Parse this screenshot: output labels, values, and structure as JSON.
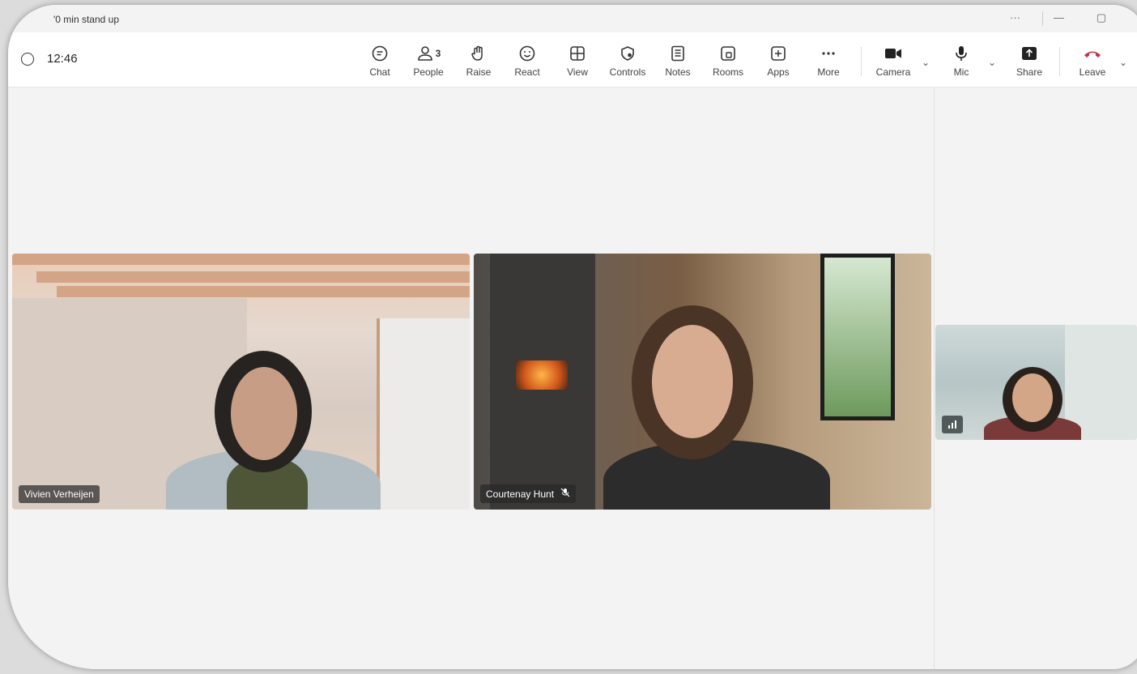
{
  "window": {
    "title": "'0 min stand up",
    "more": "···",
    "minimize": "—",
    "maximize": "▢"
  },
  "toolbar": {
    "timer": "12:46",
    "people_count": "3",
    "buttons": [
      {
        "label": "Chat",
        "icon": "chat-icon"
      },
      {
        "label": "People",
        "icon": "people-icon"
      },
      {
        "label": "Raise",
        "icon": "raise-hand-icon"
      },
      {
        "label": "React",
        "icon": "react-icon"
      },
      {
        "label": "View",
        "icon": "view-icon"
      },
      {
        "label": "Controls",
        "icon": "controls-icon"
      },
      {
        "label": "Notes",
        "icon": "notes-icon"
      },
      {
        "label": "Rooms",
        "icon": "rooms-icon"
      },
      {
        "label": "Apps",
        "icon": "apps-icon"
      },
      {
        "label": "More",
        "icon": "more-icon"
      },
      {
        "label": "Camera",
        "icon": "camera-icon"
      },
      {
        "label": "Mic",
        "icon": "mic-icon"
      },
      {
        "label": "Share",
        "icon": "share-icon"
      },
      {
        "label": "Leave",
        "icon": "leave-icon"
      }
    ],
    "leave_color": "#c4314b"
  },
  "participants": {
    "left": {
      "name": "Vivien Verheijen"
    },
    "right": {
      "name": "Courtenay Hunt",
      "muted": true
    }
  }
}
